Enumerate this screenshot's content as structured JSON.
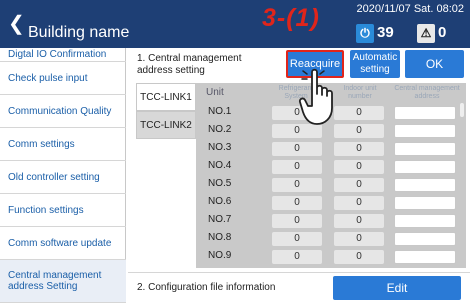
{
  "header": {
    "back_icon": "chevron-left-icon",
    "title": "Building name",
    "datetime": "2020/11/07 Sat. 08:02",
    "step_label": "3-(1)",
    "power_icon": "power-icon",
    "power_count": "39",
    "alarm_icon": "warning-icon",
    "alarm_count": "0"
  },
  "sidebar": {
    "items": [
      {
        "label": "Digtal IO Confirmation"
      },
      {
        "label": "Check pulse input"
      },
      {
        "label": "Communication Quality"
      },
      {
        "label": "Comm settings"
      },
      {
        "label": "Old controller setting"
      },
      {
        "label": "Function settings"
      },
      {
        "label": "Comm software update"
      },
      {
        "label": "Central management address Setting"
      }
    ]
  },
  "section1": {
    "label": "1. Central management address setting",
    "buttons": {
      "reacquire": "Reacquire",
      "automatic": "Automatic setting",
      "ok": "OK"
    },
    "tabs": [
      "TCC-LINK1",
      "TCC-LINK2"
    ],
    "table": {
      "headers": [
        "Unit",
        "Refrigerant System",
        "Indoor unit number",
        "Central management address"
      ],
      "rows": [
        {
          "unit": "NO.1",
          "ref": "0",
          "idx": "0",
          "cm": ""
        },
        {
          "unit": "NO.2",
          "ref": "0",
          "idx": "0",
          "cm": ""
        },
        {
          "unit": "NO.3",
          "ref": "0",
          "idx": "0",
          "cm": ""
        },
        {
          "unit": "NO.4",
          "ref": "0",
          "idx": "0",
          "cm": ""
        },
        {
          "unit": "NO.5",
          "ref": "0",
          "idx": "0",
          "cm": ""
        },
        {
          "unit": "NO.6",
          "ref": "0",
          "idx": "0",
          "cm": ""
        },
        {
          "unit": "NO.7",
          "ref": "0",
          "idx": "0",
          "cm": ""
        },
        {
          "unit": "NO.8",
          "ref": "0",
          "idx": "0",
          "cm": ""
        },
        {
          "unit": "NO.9",
          "ref": "0",
          "idx": "0",
          "cm": ""
        }
      ]
    }
  },
  "section2": {
    "label": "2. Configuration file information",
    "edit": "Edit"
  },
  "colors": {
    "header_bg": "#1e3f75",
    "accent_blue": "#2a7ad6",
    "callout_red": "#e0251b",
    "sidebar_text": "#1b5fa8"
  }
}
